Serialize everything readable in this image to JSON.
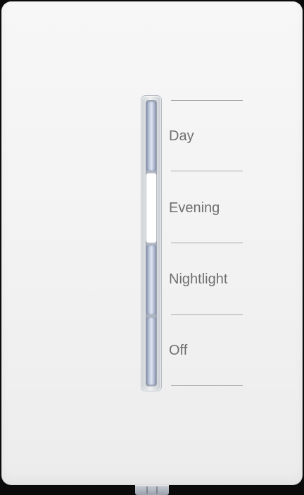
{
  "scenes": [
    {
      "label": "Day",
      "state": "standby"
    },
    {
      "label": "Evening",
      "state": "active"
    },
    {
      "label": "Nightlight",
      "state": "standby"
    },
    {
      "label": "Off",
      "state": "standby"
    }
  ],
  "colors": {
    "plate": "#f3f3f3",
    "label_text": "#6f6f6f",
    "led_active": "#ffffff",
    "led_standby": "#8e9bb3"
  },
  "icons": [
    "led-indicator-icon"
  ]
}
